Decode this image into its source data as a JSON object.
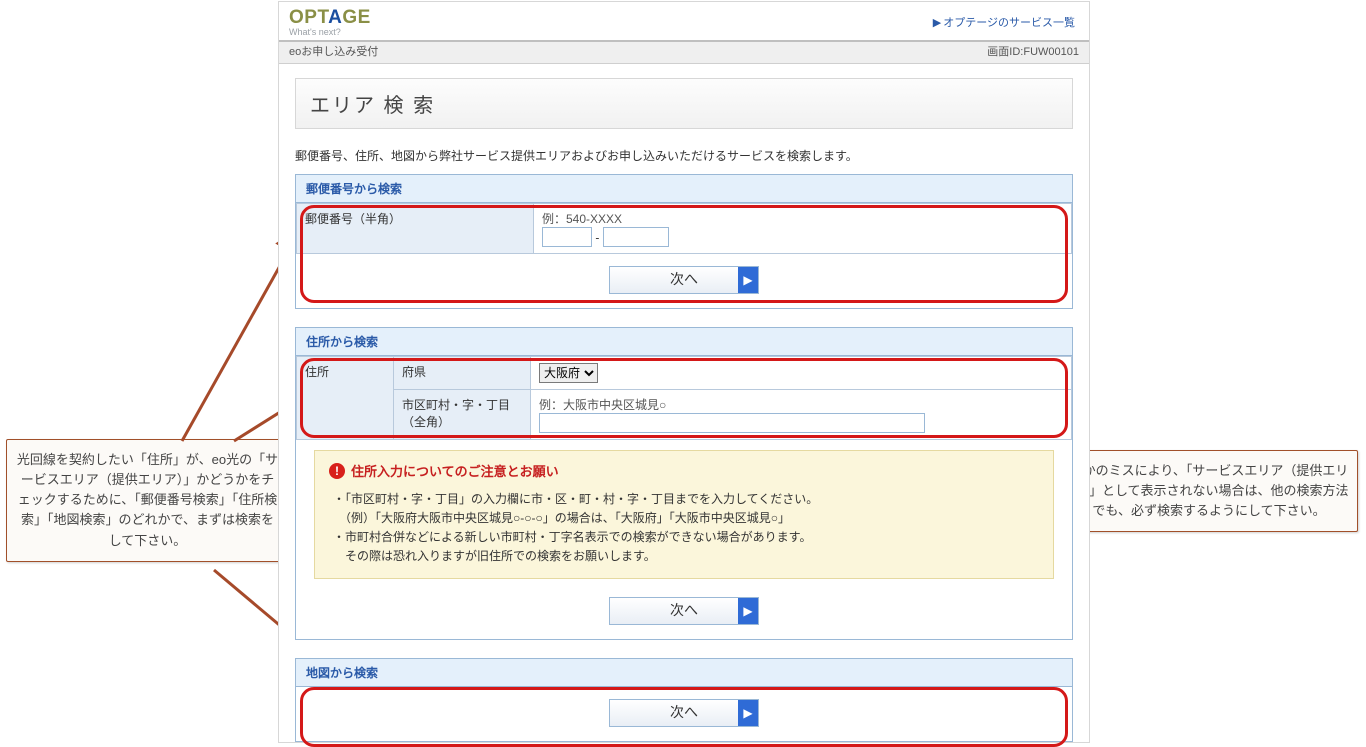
{
  "brand": {
    "main_pre": "OPT",
    "main_a": "A",
    "main_post": "GE",
    "sub": "What's next?"
  },
  "top_link": "オプテージのサービス一覧",
  "idbar": {
    "left": "eoお申し込み受付",
    "right": "画面ID:FUW00101"
  },
  "title": "エリア 検 索",
  "intro": "郵便番号、住所、地図から弊社サービス提供エリアおよびお申し込みいただけるサービスを検索します。",
  "postal": {
    "header": "郵便番号から検索",
    "label": "郵便番号（半角）",
    "example": "例：540-XXXX",
    "dash": "-",
    "next": "次へ"
  },
  "address": {
    "header": "住所から検索",
    "row_label": "住所",
    "pref_label": "府県",
    "pref_value": "大阪府",
    "city_label": "市区町村・字・丁目（全角）",
    "city_example": "例：大阪市中央区城見○",
    "next": "次へ"
  },
  "notice": {
    "title": "住所入力についてのご注意とお願い",
    "lines": [
      "・「市区町村・字・丁目」の入力欄に市・区・町・村・字・丁目までを入力してください。",
      "　（例）「大阪府大阪市中央区城見○-○-○」の場合は、「大阪府」「大阪市中央区城見○」",
      "・市町村合併などによる新しい市町村・丁字名表示での検索ができない場合があります。",
      "　その際は恐れ入りますが旧住所での検索をお願いします。"
    ]
  },
  "map": {
    "header": "地図から検索",
    "next": "次へ"
  },
  "callout_left": "光回線を契約したい「住所」が、eo光の「サービスエリア（提供エリア）」かどうかをチェックするために、「郵便番号検索」「住所検索」「地図検索」のどれかで、まずは検索をして下さい。",
  "callout_right": "何かのミスにより、「サービスエリア（提供エリア）」として表示されない場合は、他の検索方法でも、必ず検索するようにして下さい。"
}
